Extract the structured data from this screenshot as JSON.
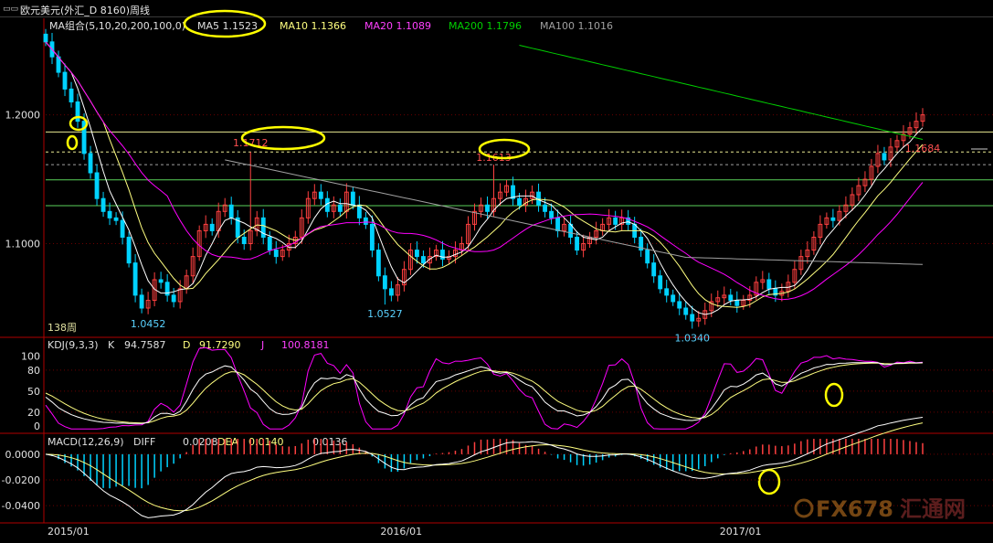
{
  "header": {
    "window_icon": "window-menu-icon",
    "title": "欧元美元(外汇_D 8160)周线"
  },
  "colors": {
    "up": "#ff4040",
    "down": "#00d2ff",
    "ma5": "#ffffff",
    "ma10": "#ffff80",
    "ma20": "#ff00ff",
    "ma200": "#00d000",
    "ma100": "#a0a0a0",
    "annotation": "#ffff00",
    "horizontal_line": "#5ad25a"
  },
  "main_panel": {
    "legend": [
      {
        "label": "MA组合(5,10,20,200,100,0)",
        "color": "#e0e0e0"
      },
      {
        "label": "MA5 1.1523",
        "color": "#e0e0e0"
      },
      {
        "label": "MA10 1.1366",
        "color": "#ffff80"
      },
      {
        "label": "MA20 1.1089",
        "color": "#ff40ff"
      },
      {
        "label": "MA200 1.1796",
        "color": "#00d000"
      },
      {
        "label": "MA100 1.1016",
        "color": "#a0a0a0"
      }
    ],
    "y_ticks": [
      "1.2000",
      "1.1000"
    ],
    "period_label": "138周",
    "price_labels": [
      "1.0452",
      "1.0527",
      "1.0340",
      "1.1712",
      "1.1613",
      "1.1684"
    ]
  },
  "kdj_panel": {
    "legend": [
      {
        "label": "KDJ(9,3,3)",
        "color": "#e0e0e0"
      },
      {
        "label": "K",
        "color": "#e0e0e0"
      },
      {
        "label": "94.7587",
        "color": "#e0e0e0"
      },
      {
        "label": "D",
        "color": "#ffff80"
      },
      {
        "label": "91.7290",
        "color": "#ffff80"
      },
      {
        "label": "J",
        "color": "#ff40ff"
      },
      {
        "label": "100.8181",
        "color": "#ff40ff"
      }
    ],
    "y_ticks": [
      "100",
      "80",
      "50",
      "20",
      "0"
    ]
  },
  "macd_panel": {
    "legend": [
      {
        "label": "MACD(12,26,9)",
        "color": "#e0e0e0"
      },
      {
        "label": "DIFF",
        "color": "#e0e0e0"
      },
      {
        "label": "0.0208",
        "color": "#e0e0e0"
      },
      {
        "label": "DEA",
        "color": "#ffff80"
      },
      {
        "label": "0.0140",
        "color": "#ffff80"
      },
      {
        "label": "0.0136",
        "color": "#e0e0e0"
      }
    ],
    "y_ticks": [
      "0.0000",
      "-0.0200",
      "-0.0400"
    ]
  },
  "x_axis": {
    "labels": [
      "2015/01",
      "2016/01",
      "2017/01"
    ]
  },
  "watermark": {
    "brand": "FX678",
    "cn": "汇通网"
  },
  "chart_data": {
    "type": "candlestick",
    "timeframe": "weekly",
    "x_start": "2015/01",
    "count": 138,
    "main": {
      "ylim": [
        1.028,
        1.265
      ],
      "y_ticks": [
        1.1,
        1.2
      ],
      "horizontal_lines": [
        1.1712,
        1.1613,
        1.1495,
        1.1295,
        1.1867
      ],
      "annotations": [
        {
          "label": "1.0452",
          "value": 1.0452
        },
        {
          "label": "1.0527",
          "value": 1.0527
        },
        {
          "label": "1.0340",
          "value": 1.034
        },
        {
          "label": "1.1712",
          "value": 1.1712
        },
        {
          "label": "1.1613",
          "value": 1.1613
        },
        {
          "label": "1.1684",
          "value": 1.1684
        }
      ],
      "close": [
        1.2566,
        1.245,
        1.233,
        1.22,
        1.21,
        1.195,
        1.17,
        1.155,
        1.135,
        1.125,
        1.12,
        1.118,
        1.105,
        1.085,
        1.06,
        1.05,
        1.056,
        1.072,
        1.07,
        1.06,
        1.055,
        1.065,
        1.075,
        1.09,
        1.11,
        1.115,
        1.11,
        1.125,
        1.13,
        1.12,
        1.105,
        1.1,
        1.11,
        1.12,
        1.105,
        1.095,
        1.09,
        1.095,
        1.1,
        1.105,
        1.12,
        1.135,
        1.14,
        1.135,
        1.125,
        1.13,
        1.125,
        1.14,
        1.13,
        1.12,
        1.115,
        1.095,
        1.075,
        1.065,
        1.06,
        1.068,
        1.08,
        1.095,
        1.09,
        1.085,
        1.09,
        1.095,
        1.088,
        1.09,
        1.095,
        1.1,
        1.115,
        1.125,
        1.13,
        1.125,
        1.135,
        1.14,
        1.145,
        1.135,
        1.13,
        1.135,
        1.14,
        1.13,
        1.125,
        1.12,
        1.11,
        1.115,
        1.105,
        1.095,
        1.1,
        1.105,
        1.11,
        1.115,
        1.12,
        1.115,
        1.12,
        1.115,
        1.105,
        1.095,
        1.085,
        1.075,
        1.065,
        1.06,
        1.055,
        1.05,
        1.045,
        1.04,
        1.042,
        1.048,
        1.055,
        1.058,
        1.06,
        1.056,
        1.052,
        1.056,
        1.06,
        1.07,
        1.072,
        1.065,
        1.06,
        1.063,
        1.07,
        1.08,
        1.09,
        1.095,
        1.105,
        1.115,
        1.12,
        1.118,
        1.125,
        1.13,
        1.138,
        1.145,
        1.15,
        1.16,
        1.17,
        1.165,
        1.175,
        1.18,
        1.185,
        1.19,
        1.195,
        1.2
      ],
      "ma5_last": 1.1523,
      "ma10_last": 1.1366,
      "ma20_last": 1.1089,
      "ma200_last": 1.1796,
      "ma100_last": 1.1016
    },
    "kdj": {
      "ylim": [
        -5,
        115
      ],
      "y_ticks": [
        0,
        20,
        50,
        80,
        100
      ],
      "K_last": 94.7587,
      "D_last": 91.729,
      "J_last": 100.8181
    },
    "macd": {
      "ylim": [
        -0.052,
        0.012
      ],
      "y_ticks": [
        0,
        -0.02,
        -0.04
      ],
      "DIFF_last": 0.0208,
      "DEA_last": 0.014,
      "MACD_last": 0.0136
    }
  }
}
